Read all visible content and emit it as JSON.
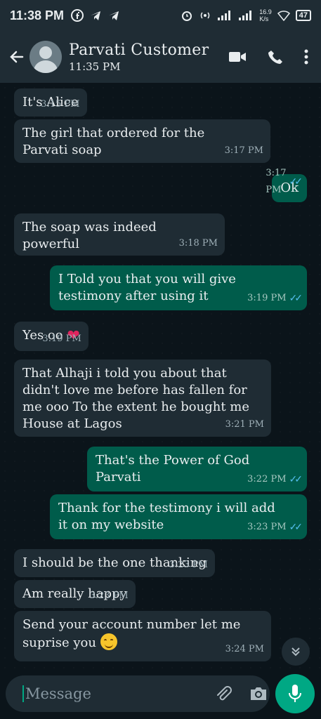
{
  "status_bar": {
    "time": "11:38 PM",
    "net_top": "16.9",
    "net_bottom": "K/s",
    "battery": "47"
  },
  "header": {
    "contact_name": "Parvati Customer",
    "subtitle": "11:35 PM"
  },
  "messages": [
    {
      "dir": "in",
      "text": "It's Alice",
      "time": "3:15 PM"
    },
    {
      "dir": "in",
      "text": "The girl that ordered for the Parvati soap",
      "time": "3:17 PM"
    },
    {
      "dir": "out",
      "text": "Ok",
      "time": "3:17 PM",
      "ticks": "✓✓"
    },
    {
      "dir": "in",
      "text": "The soap was indeed powerful",
      "time": "3:18 PM"
    },
    {
      "dir": "out",
      "text": "I Told you that you will give testimony after using it",
      "time": "3:19 PM",
      "ticks": "✓✓"
    },
    {
      "dir": "in",
      "text": "Yes oo",
      "emoji": "heart",
      "time": "3:19 PM"
    },
    {
      "dir": "in",
      "text": "That Alhaji i told you about that didn't love me before has fallen for me ooo To the extent he bought me House at Lagos",
      "time": "3:21 PM"
    },
    {
      "dir": "out",
      "text": "That's the Power of God Parvati",
      "time": "3:22 PM",
      "ticks": "✓✓"
    },
    {
      "dir": "out",
      "text": "Thank for the testimony i will add it on my website",
      "time": "3:23 PM",
      "ticks": "✓✓"
    },
    {
      "dir": "in",
      "text": "I should be the one thanking",
      "time": "3:23 PM"
    },
    {
      "dir": "in",
      "text": "Am really happy",
      "time": "3:23 PM"
    },
    {
      "dir": "in",
      "text": "Send your account number let me suprise you",
      "emoji": "smile",
      "time": "3:24 PM"
    }
  ],
  "composer": {
    "placeholder": "Message"
  },
  "colors": {
    "incoming": "#1f2c34",
    "outgoing": "#005c4b",
    "accent": "#00a884",
    "read_ticks": "#53bdeb"
  },
  "icons": [
    "facebook-icon",
    "telegram-icon",
    "alarm-icon",
    "hotspot-icon",
    "signal-icon",
    "back-arrow-icon",
    "video-call-icon",
    "phone-icon",
    "more-options-icon",
    "scroll-down-icon",
    "emoji-icon",
    "attach-icon",
    "camera-icon",
    "mic-icon"
  ]
}
